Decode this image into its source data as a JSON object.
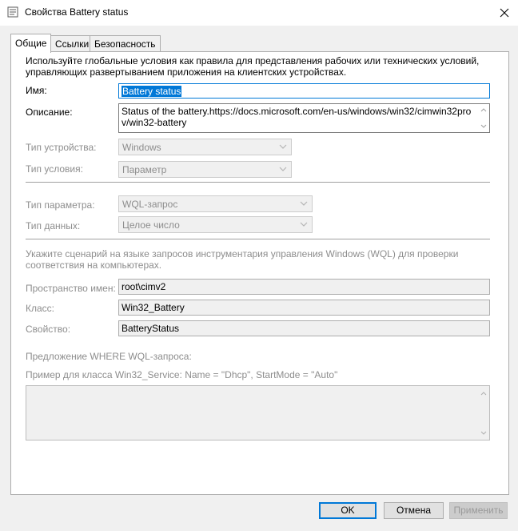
{
  "window": {
    "title": "Свойства Battery status"
  },
  "tabs": [
    {
      "label": "Общие",
      "active": true
    },
    {
      "label": "Ссылки"
    },
    {
      "label": "Безопасность"
    }
  ],
  "description": "Используйте глобальные условия как правила для представления рабочих или технических условий, управляющих развертыванием приложения на клиентских устройствах.",
  "fields": {
    "name": {
      "label": "Имя:",
      "value": "Battery status"
    },
    "description": {
      "label": "Описание:",
      "value": "Status of the battery.https://docs.microsoft.com/en-us/windows/win32/cimwin32prov/win32-battery"
    },
    "device_type": {
      "label": "Тип устройства:",
      "value": "Windows"
    },
    "condition_type": {
      "label": "Тип условия:",
      "value": "Параметр"
    },
    "setting_type": {
      "label": "Тип параметра:",
      "value": "WQL-запрос"
    },
    "data_type": {
      "label": "Тип данных:",
      "value": "Целое число"
    }
  },
  "wql": {
    "hint": "Укажите сценарий на языке запросов инструментария управления Windows (WQL) для проверки соответствия на компьютерах.",
    "namespace": {
      "label": "Пространство имен:",
      "value": "root\\cimv2"
    },
    "class": {
      "label": "Класс:",
      "value": "Win32_Battery"
    },
    "property": {
      "label": "Свойство:",
      "value": "BatteryStatus"
    },
    "where_label": "Предложение WHERE WQL-запроса:",
    "example": "Пример для класса Win32_Service: Name = \"Dhcp\", StartMode = \"Auto\"",
    "where_value": ""
  },
  "buttons": {
    "ok": "OK",
    "cancel": "Отмена",
    "apply": "Применить"
  },
  "colors": {
    "accent": "#0078d7",
    "disabled_text": "#8d8d8d"
  }
}
